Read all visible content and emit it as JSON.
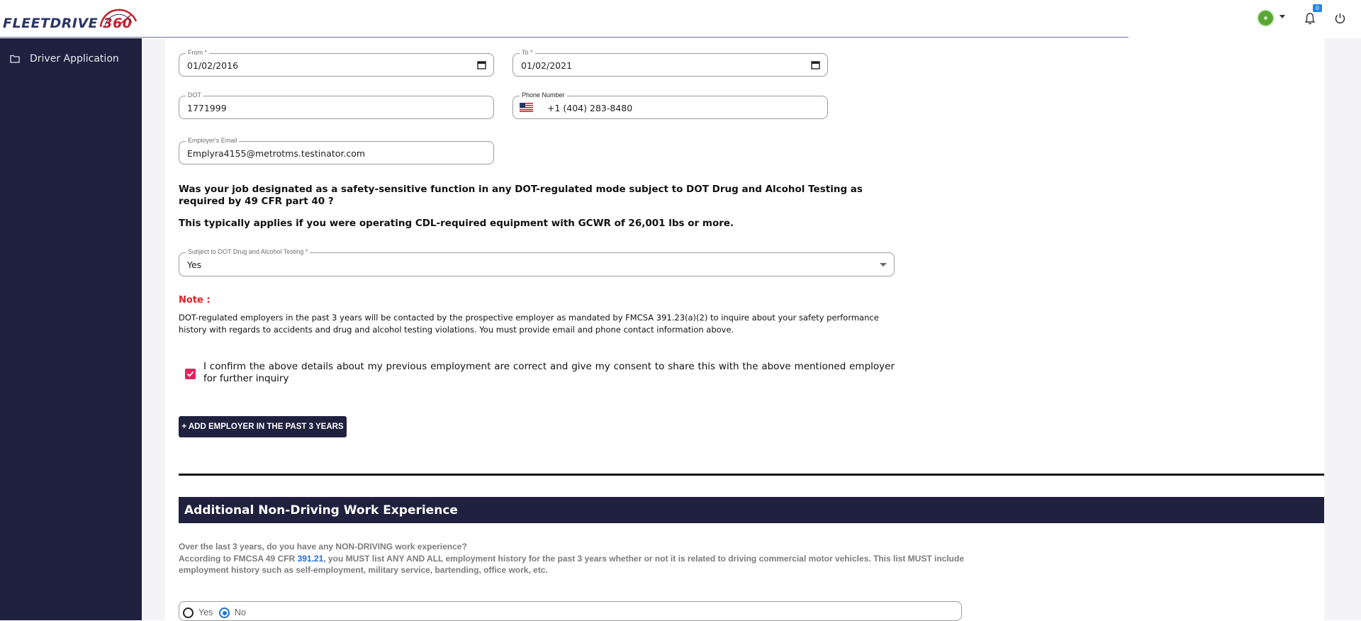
{
  "app": {
    "logo_text": "FLEETDRIVE",
    "logo_number": "360"
  },
  "header": {
    "notification_count": "0"
  },
  "sidebar": {
    "items": [
      {
        "label": "Driver Application",
        "icon": "folder-icon"
      }
    ]
  },
  "form": {
    "from": {
      "label": "From *",
      "value": "01/02/2016"
    },
    "to": {
      "label": "To *",
      "value": "01/02/2021"
    },
    "dot": {
      "label": "DOT",
      "value": "1771999"
    },
    "phone": {
      "label": "Phone Number",
      "value": "+1 (404) 283-8480"
    },
    "email": {
      "label": "Employer's Email",
      "value": "Emplyra4155@metrotms.testinator.com"
    },
    "question": "Was your job designated as a safety-sensitive function in any DOT-regulated mode subject to DOT Drug and Alcohol Testing as required by 49 CFR part 40 ?",
    "question_note": "This typically applies if you were operating CDL-required equipment with GCWR of 26,001 lbs or more.",
    "testing": {
      "label": "Subject to DOT Drug and Alcohol Testing *",
      "value": "Yes"
    },
    "note_title": "Note :",
    "note_body": "DOT-regulated employers in the past 3 years will be contacted by the prospective employer as mandated by FMCSA 391.23(a)(2) to inquire about your safety performance history with regards to accidents and drug and alcohol testing violations. You must provide email and phone contact information above.",
    "confirm_text": "I confirm the above details about my previous employment are correct and give my consent to share this with the above mentioned employer for further inquiry",
    "confirm_checked": true,
    "add_button": "+ ADD EMPLOYER IN THE PAST 3 YEARS"
  },
  "section": {
    "title": "Additional Non-Driving Work Experience",
    "line1": "Over the last 3 years, do you have any NON-DRIVING work experience?",
    "line2_prefix": "According to FMCSA 49 CFR ",
    "line2_link": "391.21",
    "line2_suffix": ", you MUST list ANY AND ALL employment history for the past 3 years whether or not it is related to driving commercial motor vehicles. This list MUST include employment history such as self-employment, military service, bartending, office work, etc.",
    "options": [
      "Yes",
      "No"
    ],
    "selected": "No"
  },
  "colors": {
    "navy": "#20213f",
    "accent_red": "#e41e26",
    "checkbox": "#e0245e",
    "link": "#1e6fd9"
  }
}
